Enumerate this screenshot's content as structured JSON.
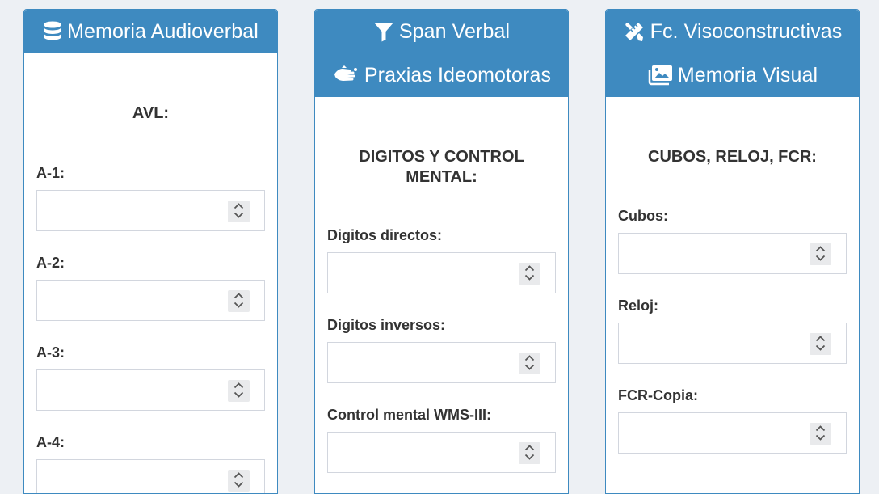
{
  "colors": {
    "header_bg": "#3e8ac0",
    "page_bg": "#edf0f4"
  },
  "cards": [
    {
      "headers": [
        {
          "icon": "database-icon",
          "title": "Memoria Audioverbal"
        }
      ],
      "section_title": "AVL:",
      "fields": [
        {
          "label": "A-1:",
          "value": ""
        },
        {
          "label": "A-2:",
          "value": ""
        },
        {
          "label": "A-3:",
          "value": ""
        },
        {
          "label": "A-4:",
          "value": ""
        }
      ]
    },
    {
      "headers": [
        {
          "icon": "filter-icon",
          "title": "Span Verbal"
        },
        {
          "icon": "sign-language-icon",
          "title": "Praxias Ideomotoras"
        }
      ],
      "section_title": "DIGITOS Y CONTROL MENTAL:",
      "fields": [
        {
          "label": "Digitos directos:",
          "value": ""
        },
        {
          "label": "Digitos inversos:",
          "value": ""
        },
        {
          "label": "Control mental WMS-III:",
          "value": ""
        }
      ]
    },
    {
      "headers": [
        {
          "icon": "pencil-ruler-icon",
          "title": "Fc. Visoconstructivas"
        },
        {
          "icon": "images-icon",
          "title": "Memoria Visual"
        }
      ],
      "section_title": "CUBOS, RELOJ, FCR:",
      "fields": [
        {
          "label": "Cubos:",
          "value": ""
        },
        {
          "label": "Reloj:",
          "value": ""
        },
        {
          "label": "FCR-Copia:",
          "value": ""
        }
      ]
    }
  ]
}
